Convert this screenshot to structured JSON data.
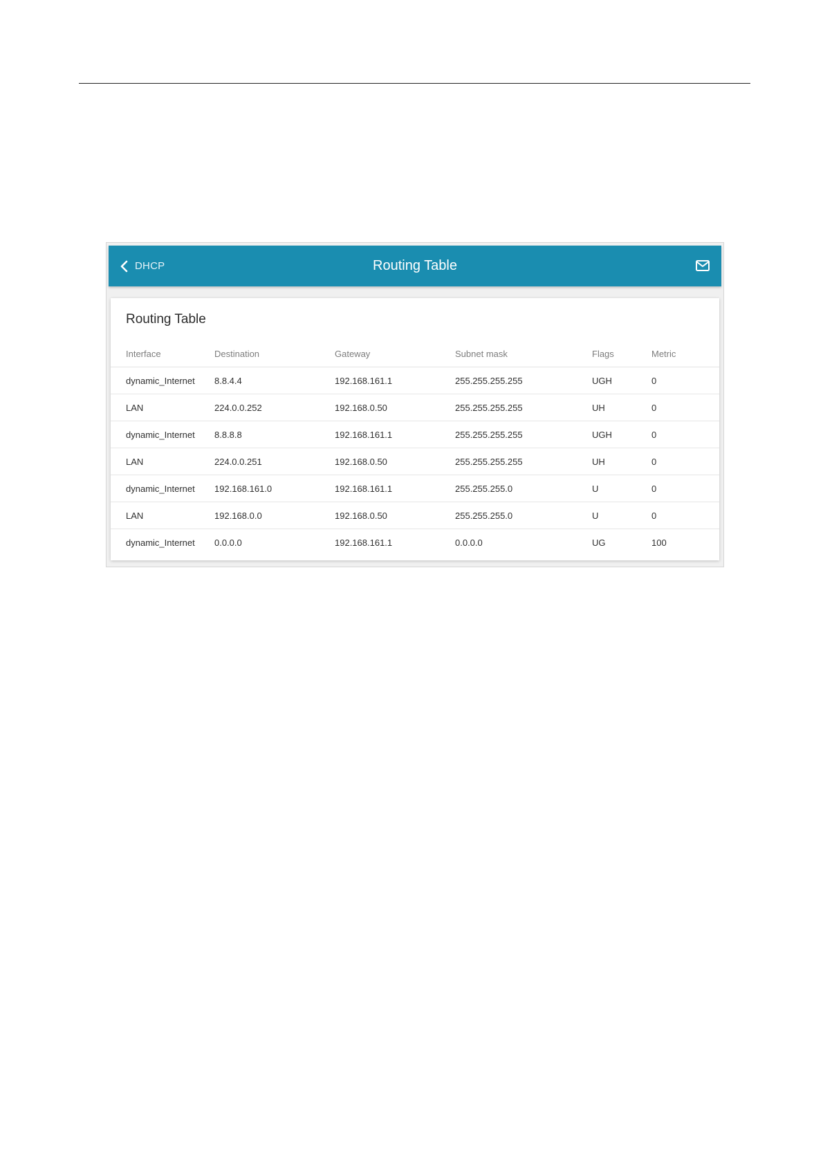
{
  "header": {
    "back_label": "DHCP",
    "title": "Routing Table"
  },
  "card": {
    "title": "Routing Table"
  },
  "table": {
    "columns": [
      "Interface",
      "Destination",
      "Gateway",
      "Subnet mask",
      "Flags",
      "Metric"
    ],
    "rows": [
      [
        "dynamic_Internet",
        "8.8.4.4",
        "192.168.161.1",
        "255.255.255.255",
        "UGH",
        "0"
      ],
      [
        "LAN",
        "224.0.0.252",
        "192.168.0.50",
        "255.255.255.255",
        "UH",
        "0"
      ],
      [
        "dynamic_Internet",
        "8.8.8.8",
        "192.168.161.1",
        "255.255.255.255",
        "UGH",
        "0"
      ],
      [
        "LAN",
        "224.0.0.251",
        "192.168.0.50",
        "255.255.255.255",
        "UH",
        "0"
      ],
      [
        "dynamic_Internet",
        "192.168.161.0",
        "192.168.161.1",
        "255.255.255.0",
        "U",
        "0"
      ],
      [
        "LAN",
        "192.168.0.0",
        "192.168.0.50",
        "255.255.255.0",
        "U",
        "0"
      ],
      [
        "dynamic_Internet",
        "0.0.0.0",
        "192.168.161.1",
        "0.0.0.0",
        "UG",
        "100"
      ]
    ]
  },
  "icons": {
    "back": "chevron-left-icon",
    "notifications": "envelope-icon"
  },
  "colors": {
    "header_bg": "#1a8db0",
    "header_text": "#ffffff"
  }
}
